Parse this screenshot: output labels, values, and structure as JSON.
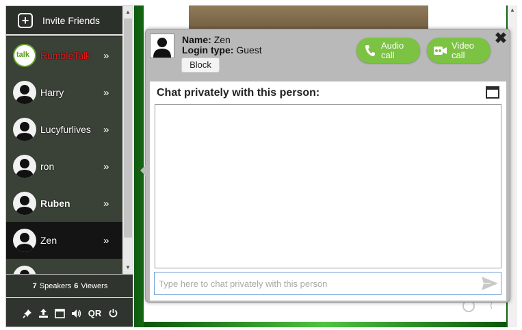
{
  "sidebar": {
    "invite_label": "Invite Friends",
    "users": [
      {
        "name": "RumbleTalk",
        "style": "red",
        "avatar": "rumbletalk-logo"
      },
      {
        "name": "Harry",
        "style": "normal",
        "avatar": "user-silhouette"
      },
      {
        "name": "Lucyfurlives",
        "style": "normal",
        "avatar": "user-silhouette"
      },
      {
        "name": "ron",
        "style": "normal",
        "avatar": "user-silhouette"
      },
      {
        "name": "Ruben",
        "style": "bold",
        "avatar": "user-silhouette"
      },
      {
        "name": "Zen",
        "style": "active",
        "avatar": "user-silhouette"
      }
    ],
    "more_glyph": "»",
    "counts": {
      "speakers_num": "7",
      "speakers_label": "Speakers",
      "viewers_num": "6",
      "viewers_label": "Viewers"
    },
    "tools": [
      {
        "icon": "pin-icon"
      },
      {
        "icon": "upload-icon"
      },
      {
        "icon": "window-icon"
      },
      {
        "icon": "volume-icon"
      },
      {
        "icon": "qr-icon",
        "label": "QR"
      },
      {
        "icon": "power-icon"
      }
    ]
  },
  "popup": {
    "name_label": "Name:",
    "name_value": "Zen",
    "login_label": "Login type:",
    "login_value": "Guest",
    "block_label": "Block",
    "audio_line1": "Audio",
    "audio_line2": "call",
    "video_line1": "Video",
    "video_line2": "call",
    "close_glyph": "✖",
    "chat_title": "Chat privately with this person:",
    "input_placeholder": "Type here to chat privately with this person"
  },
  "colors": {
    "accent_green": "#7cc243",
    "sidebar_bg": "#2f352e",
    "active_row": "#141414",
    "brand_red": "#e21b1b"
  }
}
